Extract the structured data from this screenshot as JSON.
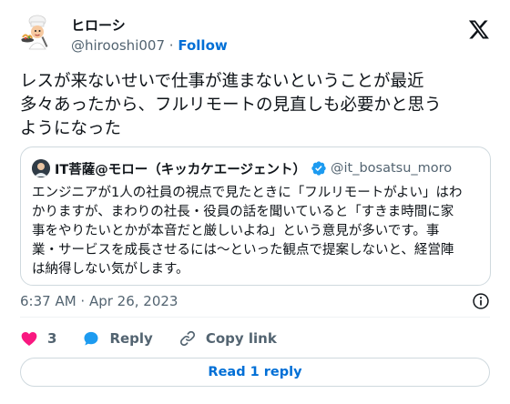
{
  "author": {
    "display_name": "ヒローシ",
    "handle": "@hirooshi007",
    "separator": "·",
    "follow_label": "Follow",
    "avatar_icon": "chef-avatar-icon"
  },
  "tweet": {
    "text": "レスが来ないせいで仕事が進まないということが最近\n多々あったから、フルリモートの見直しも必要かと思う\nようになった",
    "timestamp": "6:37 AM · Apr 26, 2023"
  },
  "quote": {
    "name": "IT菩薩@モロー（キッカケエージェント）",
    "handle": "@it_bosatsu_moro",
    "text": "エンジニアが1人の社員の視点で見たときに「フルリモートがよい」はわ\nかりますが、まわりの社長・役員の話を聞いていると「すきま時間に家\n事をやりたいとかが本音だと厳しいよね」という意見が多いです。事\n業・サービスを成長させるには〜といった観点で提案しないと、経営陣\nは納得しない気がします。"
  },
  "actions": {
    "like_count": "3",
    "reply_label": "Reply",
    "copy_link_label": "Copy link"
  },
  "read_reply_label": "Read 1 reply",
  "colors": {
    "link_blue": "#006fd6",
    "like_pink": "#f91880",
    "reply_blue": "#1d9bf0",
    "muted": "#536471",
    "border": "#cfd9de"
  }
}
